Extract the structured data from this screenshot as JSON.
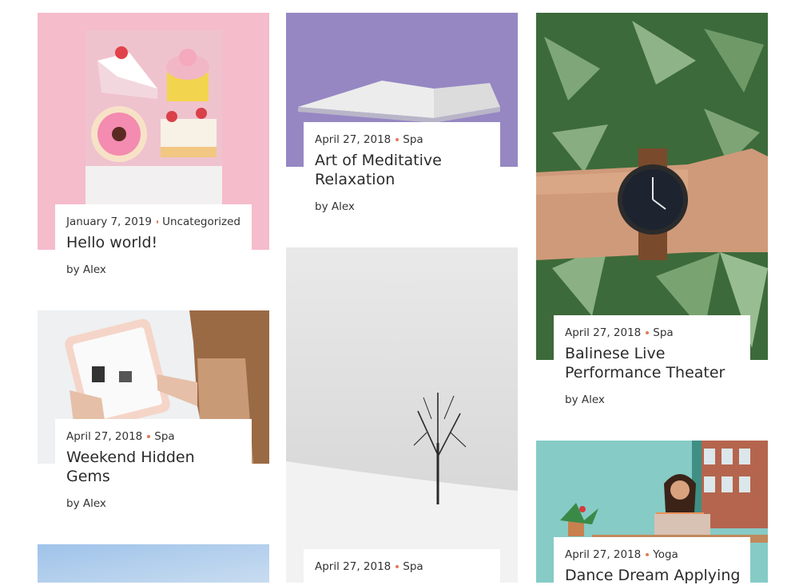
{
  "posts": [
    {
      "date": "January 7, 2019",
      "category": "Uncategorized",
      "title": "Hello world!",
      "author": "by Alex",
      "image": "pink-desserts-photo"
    },
    {
      "date": "April 27, 2018",
      "category": "Spa",
      "title": "Art of Meditative Relaxation",
      "author": "by Alex",
      "image": "open-book-on-purple-photo"
    },
    {
      "date": "April 27, 2018",
      "category": "Spa",
      "title": "Balinese Live Performance Theater",
      "author": "by Alex",
      "image": "wristwatch-and-leaves-photo"
    },
    {
      "date": "April 27, 2018",
      "category": "Spa",
      "title": "Weekend Hidden Gems",
      "author": "by Alex",
      "image": "tablet-in-hands-photo"
    },
    {
      "date": "April 27, 2018",
      "category": "Spa",
      "image": "lone-tree-in-snow-photo"
    },
    {
      "date": "April 27, 2018",
      "category": "Yoga",
      "title": "Dance Dream Applying",
      "image": "woman-with-laptop-photo"
    },
    {
      "image": "blue-sky-photo"
    }
  ]
}
